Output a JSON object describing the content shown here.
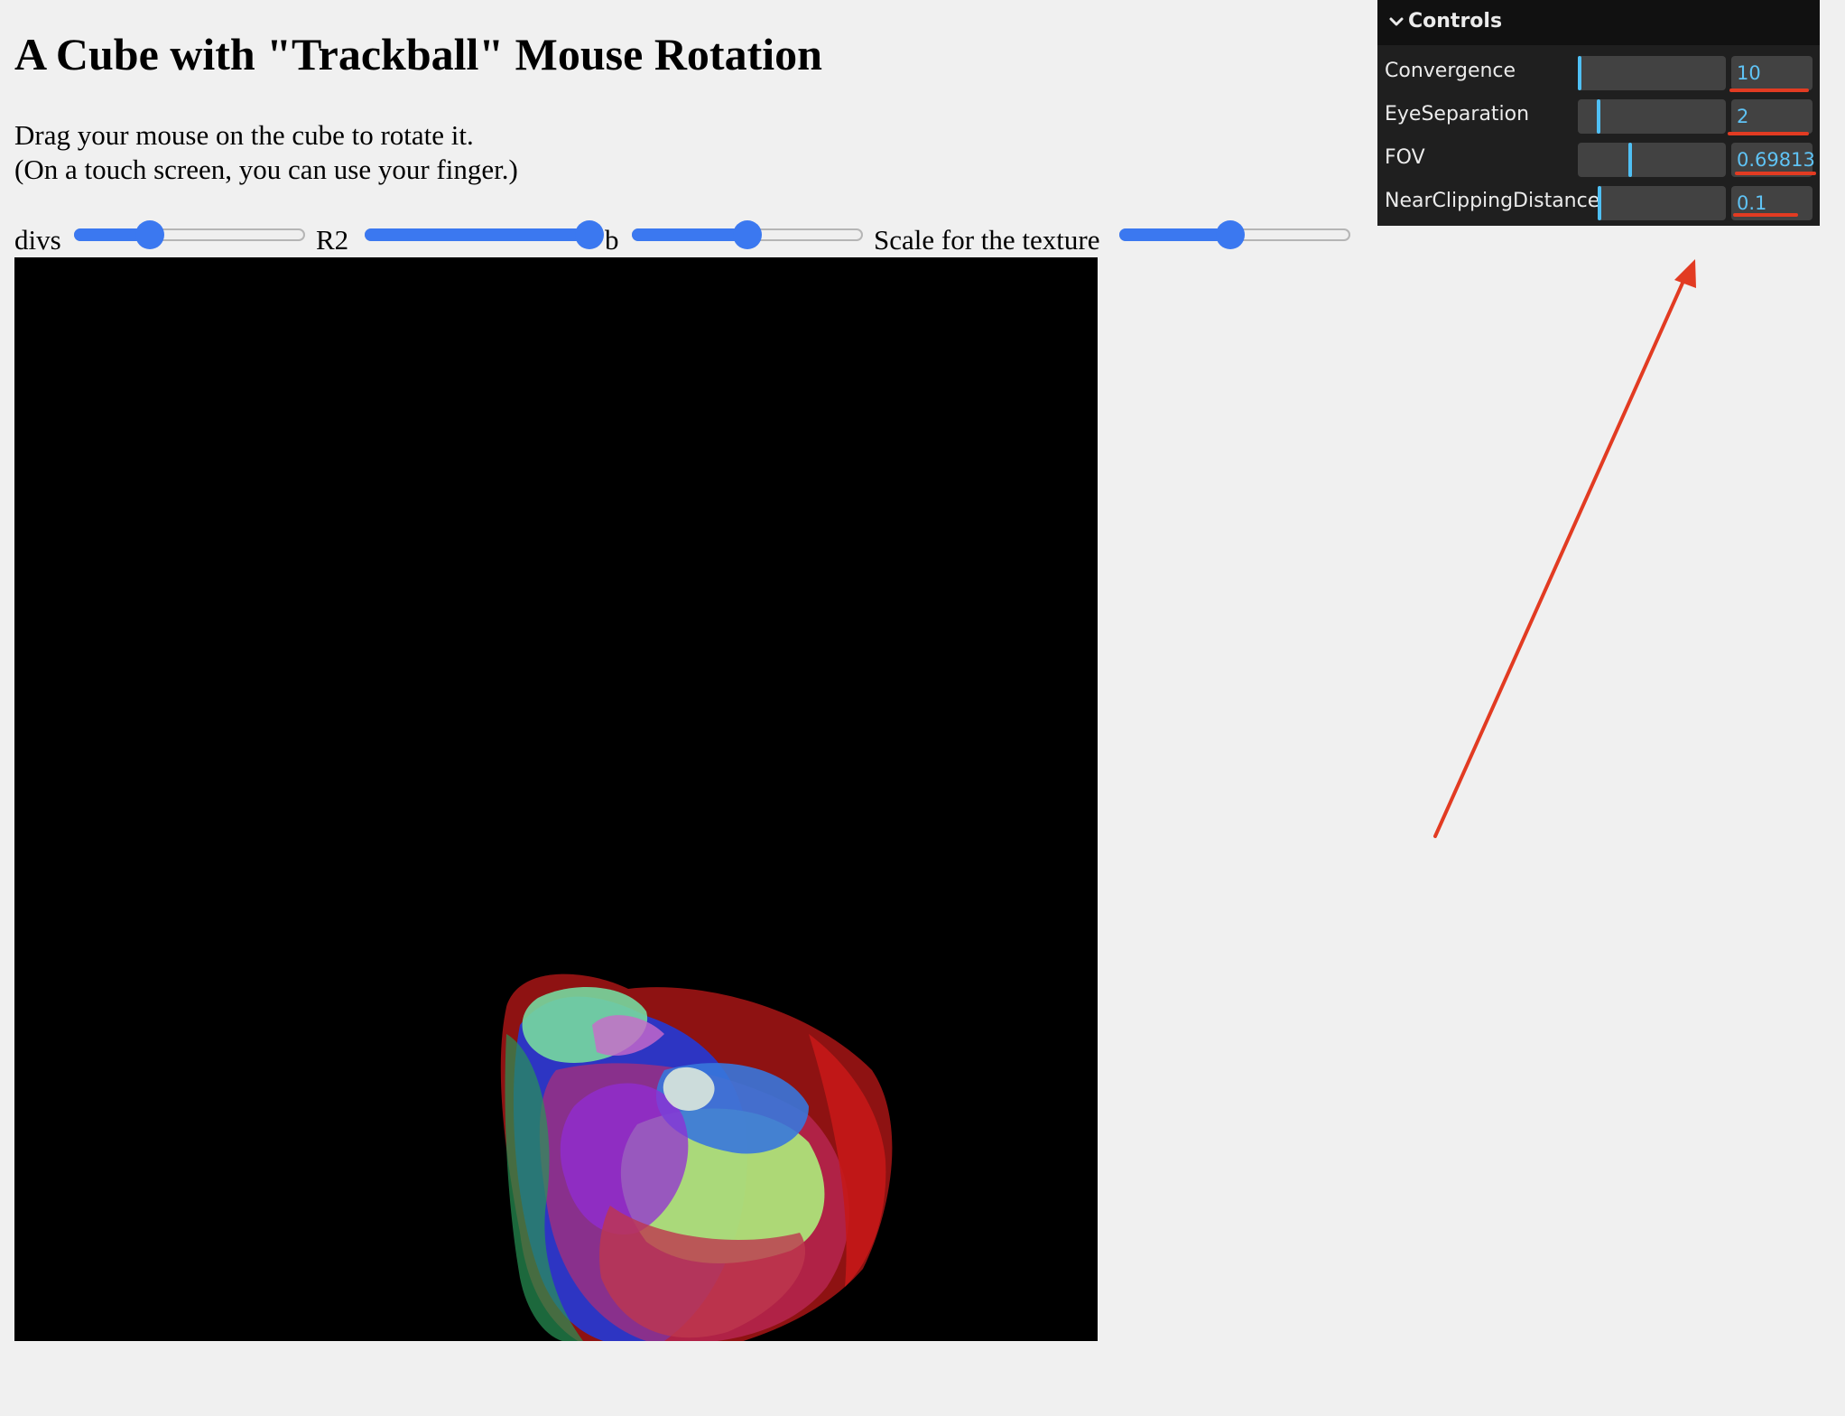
{
  "page": {
    "title": "A Cube with \"Trackball\" Mouse Rotation",
    "instructions": [
      "Drag your mouse on the cube to rotate it.",
      "(On a touch screen, you can use your finger.)"
    ]
  },
  "sliders": [
    {
      "label": "divs",
      "fraction": 0.32
    },
    {
      "label": "R2",
      "fraction": 1.0
    },
    {
      "label": "b",
      "fraction": 0.5
    },
    {
      "label": "Scale for the texture",
      "fraction": 0.48
    }
  ],
  "controls": {
    "title": "Controls",
    "items": [
      {
        "label": "Convergence",
        "value": "10",
        "fraction": 0.0
      },
      {
        "label": "EyeSeparation",
        "value": "2",
        "fraction": 0.13
      },
      {
        "label": "FOV",
        "value": "0.69813",
        "fraction": 0.35
      },
      {
        "label": "NearClippingDistance",
        "value": "0.1",
        "fraction": 0.0
      }
    ]
  },
  "colors": {
    "slider_accent": "#3b78f0",
    "gui_value": "#5fc3f5",
    "annotation_red": "#e23b22",
    "viewport_bg": "#000000"
  }
}
